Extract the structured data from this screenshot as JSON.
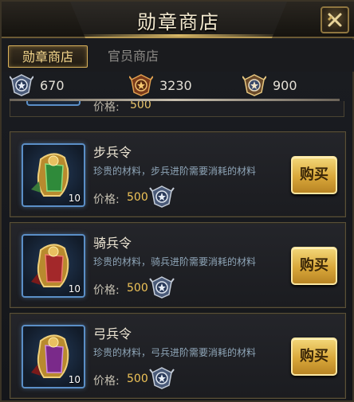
{
  "window": {
    "title": "勋章商店"
  },
  "tabs": [
    {
      "label": "勋章商店",
      "active": true
    },
    {
      "label": "官员商店",
      "active": false
    }
  ],
  "currencies": [
    {
      "icon": "silver-medal-icon",
      "value": "670"
    },
    {
      "icon": "bronze-medal-icon",
      "value": "3230"
    },
    {
      "icon": "gold-silver-medal-icon",
      "value": "900"
    }
  ],
  "partial_item": {
    "price_label": "价格:",
    "price": "500"
  },
  "items": [
    {
      "name": "步兵令",
      "description": "珍贵的材料，步兵进阶需要消耗的材料",
      "quantity": "10",
      "price_label": "价格:",
      "price": "500",
      "buy_label": "购买",
      "token_color": "#2f8a3a"
    },
    {
      "name": "骑兵令",
      "description": "珍贵的材料，骑兵进阶需要消耗的材料",
      "quantity": "10",
      "price_label": "价格:",
      "price": "500",
      "buy_label": "购买",
      "token_color": "#a3282a"
    },
    {
      "name": "弓兵令",
      "description": "珍贵的材料，弓兵进阶需要消耗的材料",
      "quantity": "10",
      "price_label": "价格:",
      "price": "500",
      "buy_label": "购买",
      "token_color": "#7a2a8a"
    }
  ],
  "colors": {
    "accent_gold": "#d9b15a",
    "price_gold": "#f0c458",
    "thumb_border": "#5b8fc7"
  }
}
